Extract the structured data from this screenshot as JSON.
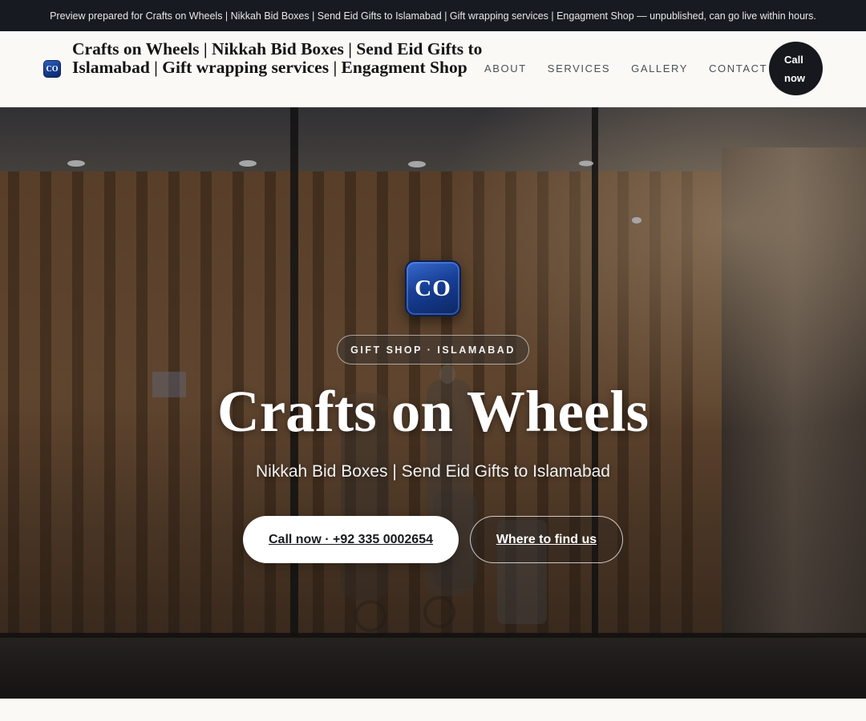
{
  "banner": {
    "text": "Preview prepared for Crafts on Wheels | Nikkah Bid Boxes | Send Eid Gifts to Islamabad | Gift wrapping services | Engagment Shop — unpublished, can go live within hours."
  },
  "header": {
    "logo_initials": "CO",
    "brand_name": "Crafts on Wheels | Nikkah Bid Boxes | Send Eid Gifts to Islamabad | Gift wrapping services | Engagment Shop",
    "nav": [
      "ABOUT",
      "SERVICES",
      "GALLERY",
      "CONTACT"
    ],
    "call_line1": "Call",
    "call_line2": "now"
  },
  "hero": {
    "logo_initials": "CO",
    "tag": "GIFT SHOP · ISLAMABAD",
    "title": "Crafts on Wheels",
    "subtitle": "Nikkah Bid Boxes | Send Eid Gifts to Islamabad",
    "primary_button": "Call now · +92 335 0002654",
    "secondary_button": "Where to find us"
  },
  "colors": {
    "banner_bg": "#171b21",
    "header_bg": "#faf9f6",
    "logo_blue": "#163f95",
    "dark_button": "#16181d"
  },
  "icons": [
    "brand-logo-badge",
    "hero-logo-badge"
  ]
}
